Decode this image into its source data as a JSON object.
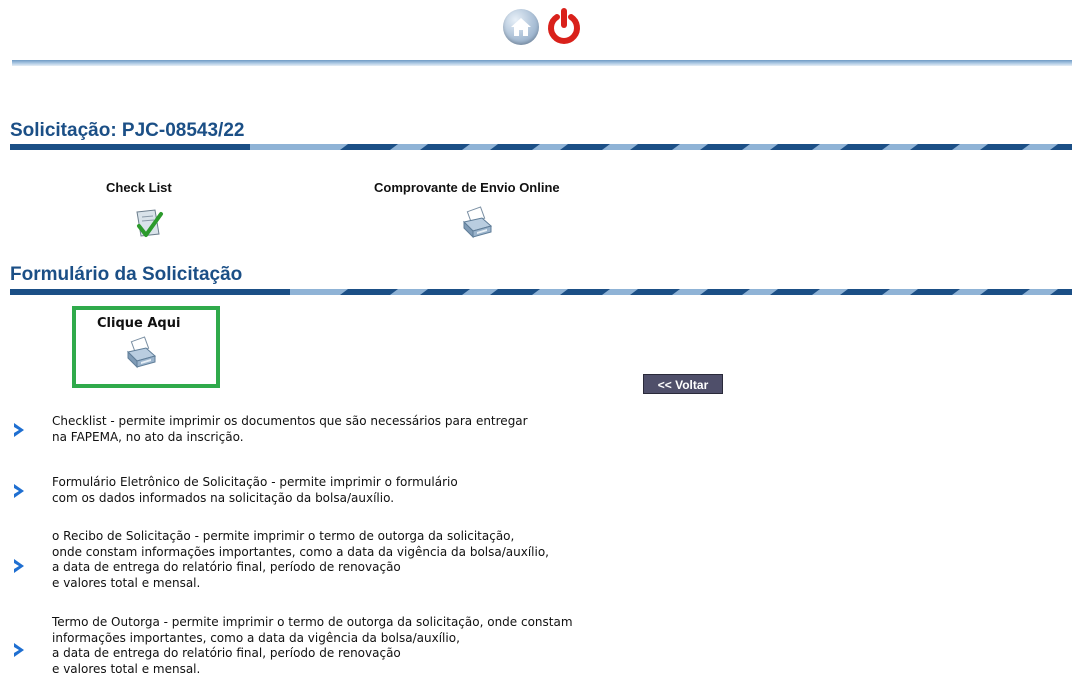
{
  "header": {
    "home_icon": "home-icon",
    "power_icon": "power-icon"
  },
  "solicitacao": {
    "title": "Solicitação: PJC-08543/22",
    "checklist_label": "Check List",
    "comprovante_label": "Comprovante de Envio Online"
  },
  "formulario": {
    "title": "Formulário da Solicitação",
    "clique_label": "Clique Aqui",
    "voltar_label": "<< Voltar"
  },
  "info": [
    {
      "lines": [
        "Checklist - permite imprimir os documentos que são necessários para entregar",
        "na FAPEMA, no ato da inscrição."
      ]
    },
    {
      "lines": [
        "Formulário Eletrônico de Solicitação - permite imprimir o formulário",
        "com os dados informados na solicitação da bolsa/auxílio."
      ]
    },
    {
      "lines": [
        "o Recibo de Solicitação - permite imprimir o termo de outorga da solicitação,",
        "onde constam informações importantes, como a data da vigência da bolsa/auxílio,",
        "a data de entrega do relatório final, período de renovação",
        "e valores total e mensal."
      ]
    },
    {
      "lines": [
        "Termo de Outorga - permite imprimir o termo de outorga da solicitação, onde constam",
        "informações importantes, como a data da vigência da bolsa/auxílio,",
        "a data de entrega do relatório final, período de renovação",
        "e valores total e mensal."
      ]
    }
  ],
  "colors": {
    "title_blue": "#1b4f86",
    "highlight_green": "#2faa4b",
    "voltar_bg": "#4f4f6a",
    "power_red": "#d9211b"
  }
}
